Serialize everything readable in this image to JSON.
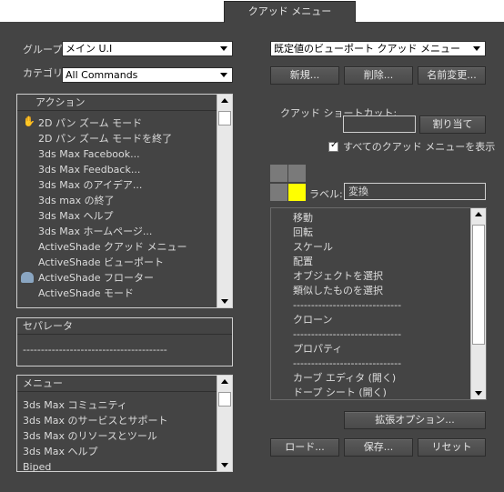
{
  "title_tab": "クアッド メニュー",
  "group": {
    "label": "グループ:",
    "value": "メイン U.I"
  },
  "category": {
    "label": "カテゴリ:",
    "value": "All Commands"
  },
  "actions": {
    "header": "アクション",
    "items": [
      "2D パン ズーム モード",
      "2D パン ズーム モードを終了",
      "3ds Max Facebook...",
      "3ds Max Feedback...",
      "3ds Max のアイデア...",
      "3ds max の終了",
      "3ds Max ヘルプ",
      "3ds Max ホームページ...",
      "ActiveShade クアッド メニュー",
      "ActiveShade ビューポート",
      "ActiveShade フローター",
      "ActiveShade モード"
    ]
  },
  "separator": {
    "header": "セパレータ",
    "item": "----------------------------------------"
  },
  "menus": {
    "header": "メニュー",
    "items": [
      "3ds Max コミュニティ",
      "3ds Max のサービスとサポート",
      "3ds Max のリソースとツール",
      "3ds Max ヘルプ",
      "Biped"
    ]
  },
  "quad_menu_select": "既定値のビューポート クアッド メニュー",
  "buttons": {
    "new": "新規...",
    "delete": "削除...",
    "rename": "名前変更...",
    "assign": "割り当て",
    "advanced": "拡張オプション...",
    "load": "ロード...",
    "save": "保存...",
    "reset": "リセット"
  },
  "shortcut": {
    "label": "クアッド ショートカット:",
    "value": ""
  },
  "show_all": {
    "label": "すべてのクアッド メニューを表示",
    "checked": true
  },
  "quad_label": {
    "label": "ラベル:",
    "value": "変換"
  },
  "quad_items": [
    "移動",
    "回転",
    "スケール",
    "配置",
    "オブジェクトを選択",
    "類似したものを選択",
    "------------------------------",
    "クローン",
    "------------------------------",
    "プロパティ",
    "------------------------------",
    "カーブ エディタ (開く)",
    "ドープ シート (開く)"
  ],
  "colors": {
    "background": "#444444",
    "accent_quad": "#ffff00"
  }
}
